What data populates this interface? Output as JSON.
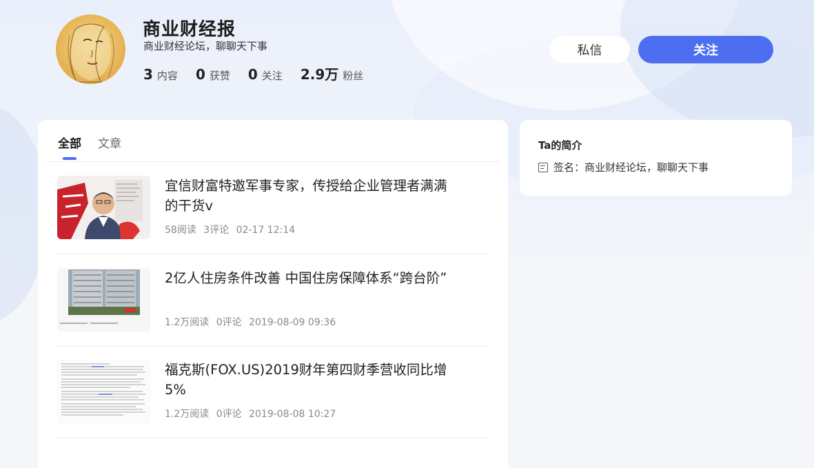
{
  "profile": {
    "name": "商业财经报",
    "tagline": "商业财经论坛，聊聊天下事",
    "stats": [
      {
        "num": "3",
        "label": "内容"
      },
      {
        "num": "0",
        "label": "获赞"
      },
      {
        "num": "0",
        "label": "关注"
      },
      {
        "num": "2.9万",
        "label": "粉丝"
      }
    ]
  },
  "actions": {
    "message_label": "私信",
    "follow_label": "关注"
  },
  "tabs": [
    {
      "label": "全部",
      "active": true
    },
    {
      "label": "文章",
      "active": false
    }
  ],
  "articles": [
    {
      "title": "宜信财富特邀军事专家，传授给企业管理者满满的干货v",
      "reads": "58阅读",
      "comments": "3评论",
      "time": "02-17 12:14"
    },
    {
      "title": "2亿人住房条件改善 中国住房保障体系“跨台阶”",
      "reads": "1.2万阅读",
      "comments": "0评论",
      "time": "2019-08-09 09:36"
    },
    {
      "title": "福克斯(FOX.US)2019财年第四财季营收同比增5%",
      "reads": "1.2万阅读",
      "comments": "0评论",
      "time": "2019-08-08 10:27"
    }
  ],
  "sidebar": {
    "title": "Ta的简介",
    "signature": "签名：商业财经论坛，聊聊天下事"
  },
  "colors": {
    "accent": "#4e6ef2"
  }
}
